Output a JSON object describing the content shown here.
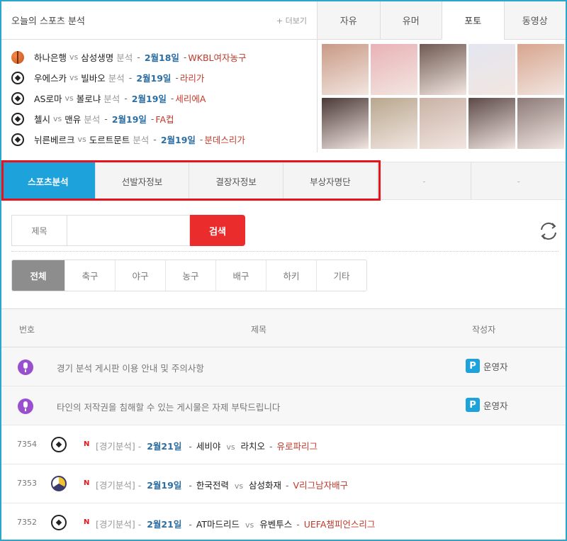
{
  "analysis": {
    "title": "오늘의 스포츠 분석",
    "more": "+ 더보기",
    "items": [
      {
        "ball": "basketball-icon",
        "home": "하나은행",
        "vs": "vs",
        "away": "삼성생명",
        "word": "분석",
        "date": "2월18일",
        "dash": "-",
        "league": "WKBL여자농구"
      },
      {
        "ball": "soccer-ball-icon",
        "home": "우에스카",
        "vs": "vs",
        "away": "빌바오",
        "word": "분석",
        "date": "2월19일",
        "dash": "-",
        "league": "라리가"
      },
      {
        "ball": "soccer-ball-icon",
        "home": "AS로마",
        "vs": "vs",
        "away": "볼로냐",
        "word": "분석",
        "date": "2월19일",
        "dash": "-",
        "league": "세리에A"
      },
      {
        "ball": "soccer-ball-icon",
        "home": "첼시",
        "vs": "vs",
        "away": "맨유",
        "word": "분석",
        "date": "2월19일",
        "dash": "-",
        "league": "FA컵"
      },
      {
        "ball": "soccer-ball-icon",
        "home": "뉘른베르크",
        "vs": "vs",
        "away": "도르트문트",
        "word": "분석",
        "date": "2월19일",
        "dash": "-",
        "league": "분데스리가"
      }
    ]
  },
  "photo_tabs": [
    "자유",
    "유머",
    "포토",
    "동영상"
  ],
  "photo_tab_active": "포토",
  "photo_colors": [
    "#c99a86",
    "#e9b2b6",
    "#6f5a52",
    "#e3e6f0",
    "#d7a58e",
    "#4b3a37",
    "#b8a78e",
    "#c9b2a5",
    "#5c4a48",
    "#8c7a77"
  ],
  "tabs": [
    {
      "label": "스포츠분석",
      "active": true
    },
    {
      "label": "선발자정보",
      "active": false
    },
    {
      "label": "결장자정보",
      "active": false
    },
    {
      "label": "부상자명단",
      "active": false
    },
    {
      "label": "-",
      "active": false
    },
    {
      "label": "-",
      "active": false
    }
  ],
  "search": {
    "label": "제목",
    "value": "",
    "button": "검색"
  },
  "filters": [
    "전체",
    "축구",
    "야구",
    "농구",
    "배구",
    "하키",
    "기타"
  ],
  "table": {
    "headers": {
      "num": "번호",
      "title": "제목",
      "author": "작성자"
    },
    "notices": [
      {
        "text": "경기 분석 게시판 이용 안내 및 주의사항",
        "author": "운영자"
      },
      {
        "text": "타인의 저작권을 침해할 수 있는 게시물은 자제 부탁드립니다",
        "author": "운영자"
      }
    ],
    "posts": [
      {
        "num": "7354",
        "ball": "soccer-ball-icon",
        "new": "N",
        "category": "[경기분석] -",
        "date": "2월21일",
        "dash": "-",
        "home": "세비야",
        "vs": "vs",
        "away": "라치오",
        "dash2": "-",
        "league": "유로파리그"
      },
      {
        "num": "7353",
        "ball": "volleyball-icon",
        "new": "N",
        "category": "[경기분석] -",
        "date": "2월19일",
        "dash": "-",
        "home": "한국전력",
        "vs": "vs",
        "away": "삼성화재",
        "dash2": "-",
        "league": "V리그남자배구"
      },
      {
        "num": "7352",
        "ball": "soccer-ball-icon",
        "new": "N",
        "category": "[경기분석] -",
        "date": "2월21일",
        "dash": "-",
        "home": "AT마드리드",
        "vs": "vs",
        "away": "유벤투스",
        "dash2": "-",
        "league": "UEFA챔피언스리그"
      }
    ]
  },
  "colors": {
    "accent": "#1ea2dc",
    "search_button": "#ea2c2c",
    "highlight": "#e8141d",
    "league": "#c0392b",
    "date": "#2d6ea3"
  }
}
